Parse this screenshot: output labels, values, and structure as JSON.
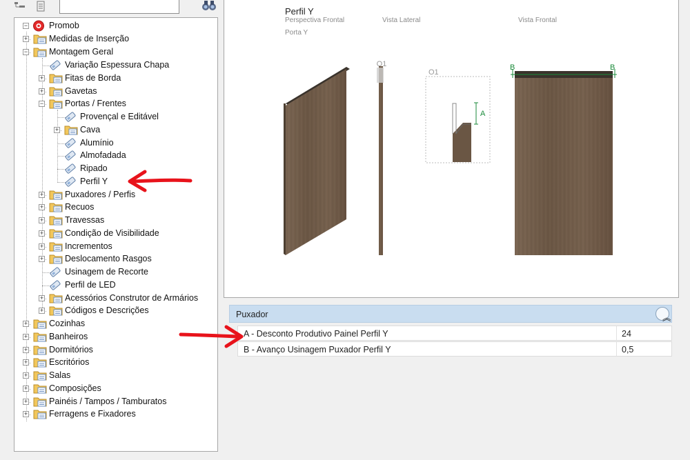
{
  "tree": {
    "root": "Promob",
    "items": [
      {
        "label": "Medidas de Inserção"
      },
      {
        "label": "Montagem Geral"
      },
      {
        "label": "Variação Espessura Chapa"
      },
      {
        "label": "Fitas de Borda"
      },
      {
        "label": "Gavetas"
      },
      {
        "label": "Portas / Frentes"
      },
      {
        "label": "Provençal e Editável"
      },
      {
        "label": "Cava"
      },
      {
        "label": "Alumínio"
      },
      {
        "label": "Almofadada"
      },
      {
        "label": "Ripado"
      },
      {
        "label": "Perfil Y"
      },
      {
        "label": "Puxadores / Perfis"
      },
      {
        "label": "Recuos"
      },
      {
        "label": "Travessas"
      },
      {
        "label": "Condição de Visibilidade"
      },
      {
        "label": "Incrementos"
      },
      {
        "label": "Deslocamento Rasgos"
      },
      {
        "label": "Usinagem de Recorte"
      },
      {
        "label": "Perfil de LED"
      },
      {
        "label": "Acessórios Construtor de Armários"
      },
      {
        "label": "Códigos e Descrições"
      },
      {
        "label": "Cozinhas"
      },
      {
        "label": "Banheiros"
      },
      {
        "label": "Dormitórios"
      },
      {
        "label": "Escritórios"
      },
      {
        "label": "Salas"
      },
      {
        "label": "Composições"
      },
      {
        "label": "Painéis / Tampos / Tamburatos"
      },
      {
        "label": "Ferragens e Fixadores"
      }
    ]
  },
  "preview": {
    "title": "Perfil Y",
    "perspective_label": "Perspectiva Frontal",
    "side_label": "Vista Lateral",
    "front_label": "Vista Frontal",
    "part_label": "Porta Y",
    "o1_label_a": "O1",
    "o1_label_b": "O1",
    "dim_a": "A",
    "dim_b_left": "B",
    "dim_b_right": "B"
  },
  "properties": {
    "section_title": "Puxador",
    "rows": [
      {
        "label": "A - Desconto Produtivo Painel Perfil Y",
        "value": "24"
      },
      {
        "label": "B - Avanço Usinagem Puxador Perfil Y",
        "value": "0,5"
      }
    ]
  },
  "colors": {
    "wood": "#6e5a48",
    "header_blue": "#c9ddf0",
    "annotation_red": "#e8131b",
    "dimension_green": "#1a8a3a"
  }
}
